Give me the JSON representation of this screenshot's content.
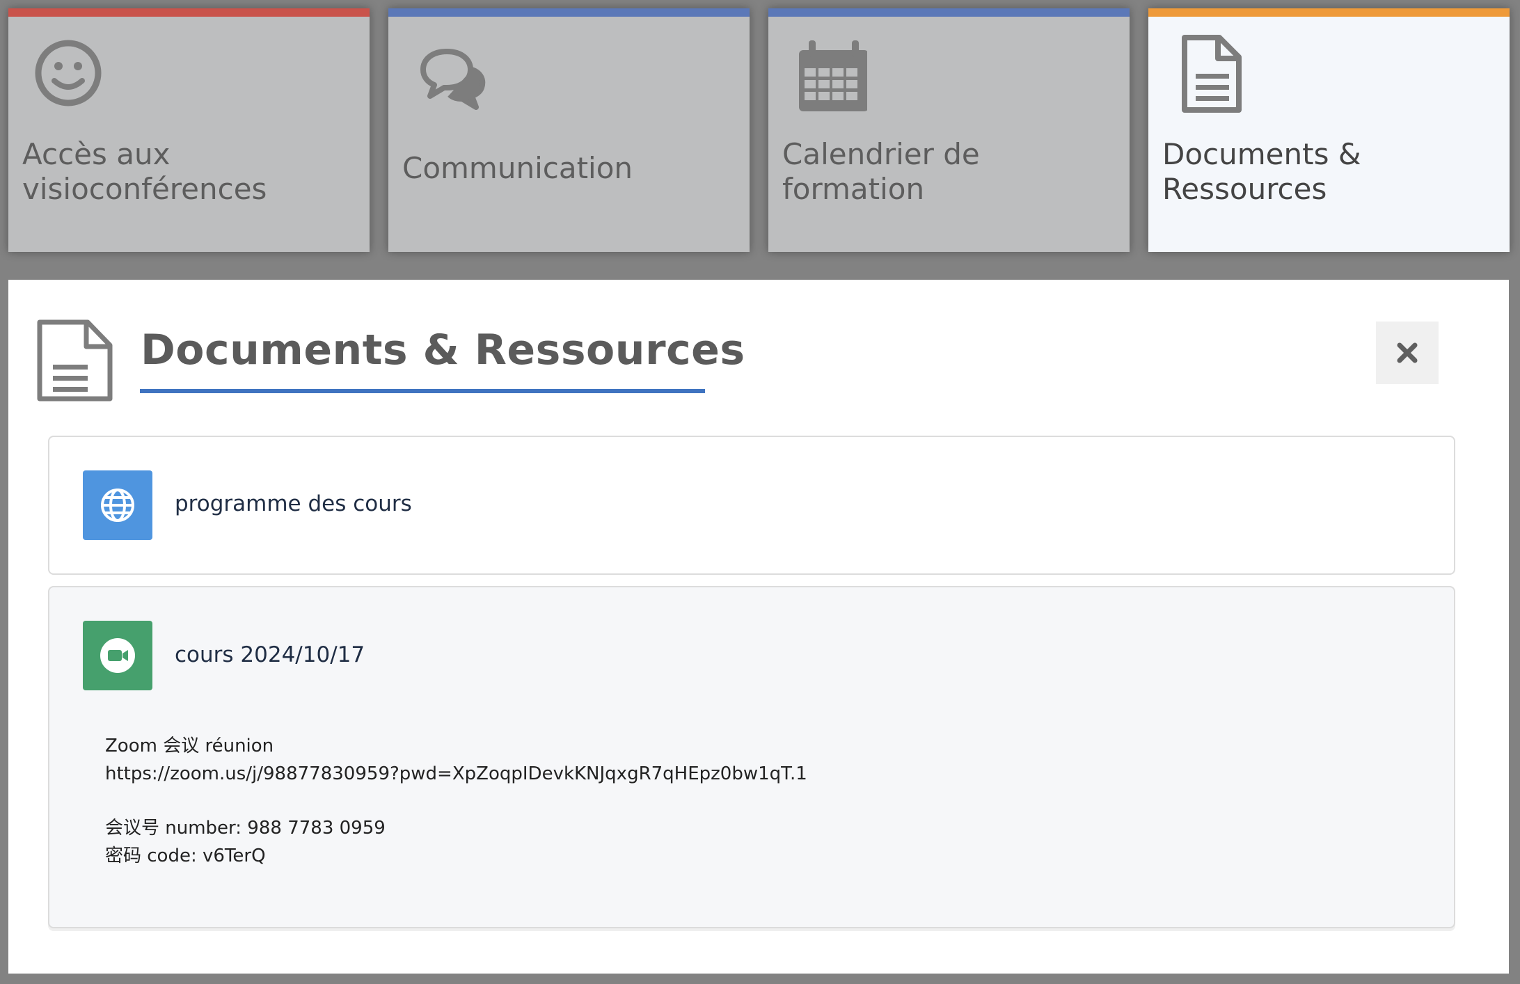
{
  "tiles": [
    {
      "label": "Accès aux\nvisioconférences",
      "icon": "smile-icon",
      "accent": "#c9534b",
      "active": false
    },
    {
      "label": "Communication",
      "icon": "chat-bubbles-icon",
      "accent": "#5b78b8",
      "active": false
    },
    {
      "label": "Calendrier de\nformation",
      "icon": "calendar-icon",
      "accent": "#5b78b8",
      "active": false
    },
    {
      "label": "Documents &\nRessources",
      "icon": "document-icon",
      "accent": "#ee9a3a",
      "active": true
    }
  ],
  "panel": {
    "title": "Documents & Ressources",
    "icon": "document-icon",
    "close_icon": "close-icon",
    "underline_color": "#3f73c0"
  },
  "items": [
    {
      "title": "programme des cours",
      "icon": "globe-icon",
      "icon_bg": "#4f95df"
    },
    {
      "title": "cours 2024/10/17",
      "icon": "video-camera-icon",
      "icon_bg": "#46a06d",
      "body": {
        "line1": "Zoom 会议 réunion",
        "line2": "https://zoom.us/j/98877830959?pwd=XpZoqpIDevkKNJqxgR7qHEpz0bw1qT.1",
        "line3": "会议号 number: 988 7783 0959",
        "line4": "密码 code: v6TerQ"
      }
    }
  ]
}
